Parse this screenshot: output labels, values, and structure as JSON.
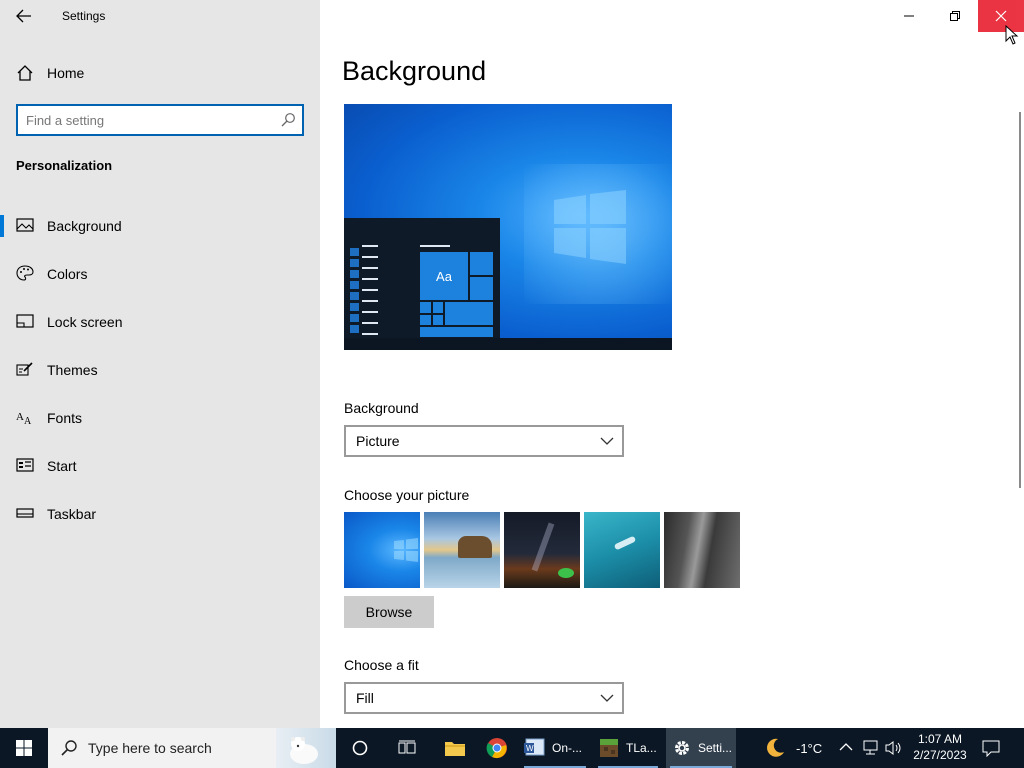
{
  "window": {
    "app_title": "Settings"
  },
  "sidebar": {
    "home_label": "Home",
    "search_placeholder": "Find a setting",
    "section_title": "Personalization",
    "items": [
      {
        "label": "Background",
        "icon": "picture-icon",
        "active": true
      },
      {
        "label": "Colors",
        "icon": "palette-icon",
        "active": false
      },
      {
        "label": "Lock screen",
        "icon": "lock-screen-icon",
        "active": false
      },
      {
        "label": "Themes",
        "icon": "brush-icon",
        "active": false
      },
      {
        "label": "Fonts",
        "icon": "font-icon",
        "active": false
      },
      {
        "label": "Start",
        "icon": "start-icon",
        "active": false
      },
      {
        "label": "Taskbar",
        "icon": "taskbar-icon",
        "active": false
      }
    ]
  },
  "main": {
    "page_title": "Background",
    "preview_tile_text": "Aa",
    "background_label": "Background",
    "background_value": "Picture",
    "choose_picture_label": "Choose your picture",
    "browse_label": "Browse",
    "fit_label": "Choose a fit",
    "fit_value": "Fill"
  },
  "taskbar": {
    "search_text": "Type here to search",
    "apps": [
      {
        "label": "On-...",
        "icon": "word-icon"
      },
      {
        "label": "TLa...",
        "icon": "minecraft-icon"
      },
      {
        "label": "Setti...",
        "icon": "settings-gear-icon"
      }
    ],
    "weather": "-1°C",
    "time": "1:07 AM",
    "date": "2/27/2023"
  },
  "colors": {
    "accent": "#0078d7",
    "sidebar_bg": "#e6e6e6",
    "taskbar_bg": "#0b1724",
    "close_hover": "#e81123"
  }
}
